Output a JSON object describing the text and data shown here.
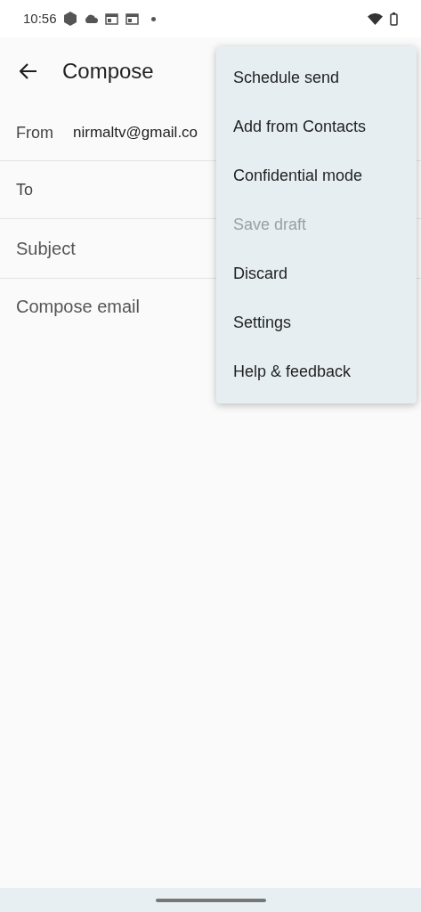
{
  "status_bar": {
    "time": "10:56"
  },
  "app_bar": {
    "title": "Compose"
  },
  "from": {
    "label": "From",
    "value": "nirmaltv@gmail.co"
  },
  "to": {
    "placeholder": "To"
  },
  "subject": {
    "placeholder": "Subject"
  },
  "body": {
    "placeholder": "Compose email"
  },
  "menu": [
    {
      "label": "Schedule send",
      "disabled": false
    },
    {
      "label": "Add from Contacts",
      "disabled": false
    },
    {
      "label": "Confidential mode",
      "disabled": false
    },
    {
      "label": "Save draft",
      "disabled": true
    },
    {
      "label": "Discard",
      "disabled": false
    },
    {
      "label": "Settings",
      "disabled": false
    },
    {
      "label": "Help & feedback",
      "disabled": false
    }
  ]
}
